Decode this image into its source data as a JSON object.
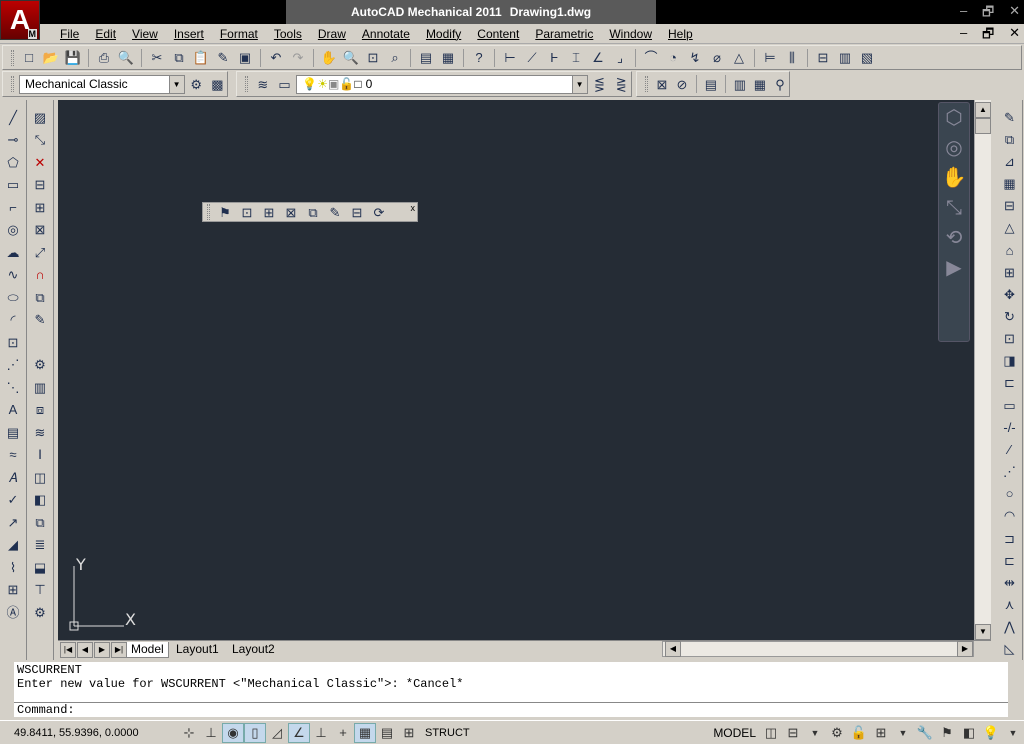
{
  "app": {
    "title": "AutoCAD Mechanical 2011",
    "filename": "Drawing1.dwg",
    "logo_letter": "A",
    "logo_badge": "M",
    "window_controls": [
      "–",
      "🗗",
      "✕"
    ]
  },
  "menu": {
    "items": [
      "File",
      "Edit",
      "View",
      "Insert",
      "Format",
      "Tools",
      "Draw",
      "Annotate",
      "Modify",
      "Content",
      "Parametric",
      "Window",
      "Help"
    ]
  },
  "workspace": {
    "value": "Mechanical Classic"
  },
  "layer": {
    "value": "0"
  },
  "floating_toolbar": {
    "close": "x"
  },
  "ucs": {
    "x_label": "X",
    "y_label": "Y"
  },
  "tabs": {
    "model": "Model",
    "layout1": "Layout1",
    "layout2": "Layout2"
  },
  "command": {
    "history_line1": "WSCURRENT",
    "history_line2": "Enter new value for WSCURRENT <\"Mechanical Classic\">: *Cancel*",
    "prompt": "Command:"
  },
  "status": {
    "coordinates": "49.8411, 55.9396, 0.0000",
    "struct": "STRUCT",
    "model": "MODEL"
  },
  "colors": {
    "canvas": "#252c35",
    "title_bg": "#000000",
    "chrome": "#d4d0c8"
  }
}
